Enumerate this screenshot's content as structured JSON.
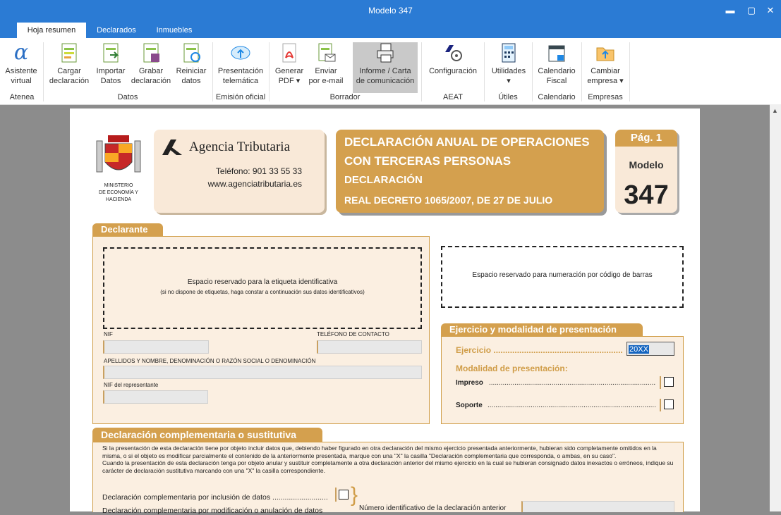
{
  "window": {
    "title": "Modelo 347",
    "minimize": "▬",
    "maximize": "▢",
    "close": "✕"
  },
  "tabs": [
    "Hoja resumen",
    "Declarados",
    "Inmuebles"
  ],
  "ribbon": {
    "buttons": [
      {
        "l1": "Asistente",
        "l2": "virtual"
      },
      {
        "l1": "Cargar",
        "l2": "declaración"
      },
      {
        "l1": "Importar",
        "l2": "Datos"
      },
      {
        "l1": "Grabar",
        "l2": "declaración"
      },
      {
        "l1": "Reiniciar",
        "l2": "datos"
      },
      {
        "l1": "Presentación",
        "l2": "telemática"
      },
      {
        "l1": "Generar",
        "l2": "PDF ▾"
      },
      {
        "l1": "Enviar",
        "l2": "por e-mail"
      },
      {
        "l1": "Informe / Carta",
        "l2": "de comunicación"
      },
      {
        "l1": "Configuración",
        "l2": ""
      },
      {
        "l1": "Utilidades",
        "l2": "▾"
      },
      {
        "l1": "Calendario",
        "l2": "Fiscal"
      },
      {
        "l1": "Cambiar",
        "l2": "empresa ▾"
      }
    ],
    "groups": [
      "Atenea",
      "Datos",
      "Emisión oficial",
      "Borrador",
      "AEAT",
      "Útiles",
      "Calendario",
      "Empresas"
    ]
  },
  "form": {
    "ministry": [
      "MINISTERIO",
      "DE ECONOMÍA Y",
      "HACIENDA"
    ],
    "agency": "Agencia Tributaria",
    "phone": "Teléfono: 901 33 55 33",
    "web": "www.agenciatributaria.es",
    "title1": "DECLARACIÓN ANUAL DE OPERACIONES",
    "title2": "CON TERCERAS PERSONAS",
    "title3": "DECLARACIÓN",
    "title4": "REAL DECRETO 1065/2007, DE 27 DE JULIO",
    "page": "Pág. 1",
    "modelo_label": "Modelo",
    "modelo_num": "347",
    "declarante": "Declarante",
    "label_space1": "Espacio reservado para la etiqueta identificativa",
    "label_space2": "(si no dispone de etiquetas, haga constar a continuación sus datos identificativos)",
    "barcode_space": "Espacio reservado para numeración por código de barras",
    "nif": "NIF",
    "phone_contact": "TELÉFONO DE CONTACTO",
    "name_label": "APELLIDOS Y NOMBRE, DENOMINACIÓN O RAZÓN SOCIAL O DENOMINACIÓN",
    "nif_rep": "NIF del representante",
    "ejercicio_hdr": "Ejercicio y modalidad de presentación",
    "ejercicio_label": "Ejercicio .......................................................",
    "ejercicio_value": "20XX",
    "modalidad": "Modalidad de presentación:",
    "impreso": "Impreso",
    "soporte": "Soporte",
    "dots": "..........................................................................................",
    "compl_hdr": "Declaración complementaria o sustitutiva",
    "compl_p1": "Si la presentación de esta declaración tiene por objeto incluir datos que, debiendo haber figurado en otra declaración del mismo ejercicio presentada anteriormente, hubieran sido completamente omitidos en la misma, o si el  objeto es modificar parcialmente el contenido de la anteriormente presentada, marque con una \"X\" la casilla \"Declaración complementaria que corresponda, o ambas, en su caso\".",
    "compl_p2": "Cuando la presentación de esta declaración tenga por objeto anular y sustituir completamente a otra declaración anterior del mismo ejercicio en la cual se hubieran consignado datos inexactos o erróneos, indique su carácter de declaración sustitutiva marcando con una \"X\" la casilla correspondiente.",
    "compl_inclusion": "Declaración complementaria por inclusión de datos ...........................",
    "compl_modif": "Declaración complementaria por modificación o anulación de datos",
    "num_ident": "Número identificativo de la declaración anterior"
  }
}
